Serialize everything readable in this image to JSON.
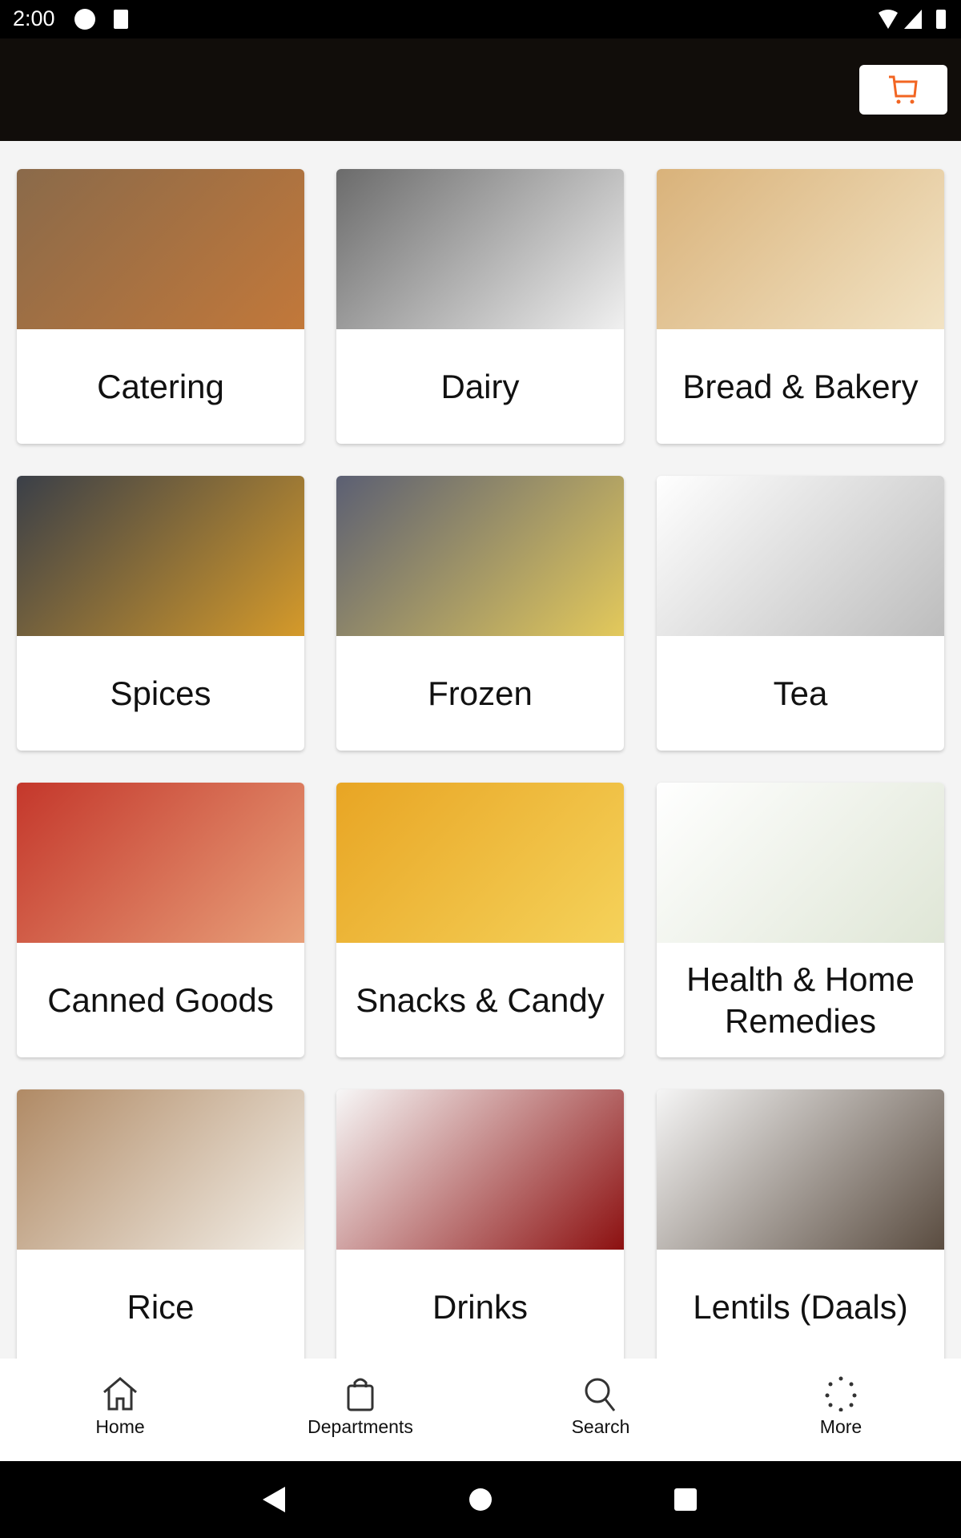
{
  "status_bar": {
    "time": "2:00"
  },
  "header": {
    "cart_icon": "shopping-cart-icon",
    "accent": "#f26522"
  },
  "categories": [
    {
      "label": "Catering",
      "colors": [
        "#8a6a4a",
        "#c2783a"
      ]
    },
    {
      "label": "Dairy",
      "colors": [
        "#6b6b6b",
        "#f0f0f0"
      ]
    },
    {
      "label": "Bread & Bakery",
      "colors": [
        "#d9b27a",
        "#f2e3c4"
      ]
    },
    {
      "label": "Spices",
      "colors": [
        "#3a3f48",
        "#d59a2a"
      ]
    },
    {
      "label": "Frozen",
      "colors": [
        "#5b5f73",
        "#e3c95b"
      ]
    },
    {
      "label": "Tea",
      "colors": [
        "#ffffff",
        "#bdbdbd"
      ]
    },
    {
      "label": "Canned Goods",
      "colors": [
        "#c4372b",
        "#e8a07a"
      ]
    },
    {
      "label": "Snacks & Candy",
      "colors": [
        "#e8a524",
        "#f5d25a"
      ]
    },
    {
      "label": "Health & Home Remedies",
      "colors": [
        "#ffffff",
        "#dfe6d6"
      ]
    },
    {
      "label": "Rice",
      "colors": [
        "#b08a65",
        "#f3efe8"
      ]
    },
    {
      "label": "Drinks",
      "colors": [
        "#f7f7f7",
        "#8c1010"
      ]
    },
    {
      "label": "Lentils (Daals)",
      "colors": [
        "#f5f5f5",
        "#5a4c40"
      ]
    }
  ],
  "bottom_nav": [
    {
      "label": "Home",
      "icon": "home-icon"
    },
    {
      "label": "Departments",
      "icon": "shopping-bag-icon"
    },
    {
      "label": "Search",
      "icon": "search-icon"
    },
    {
      "label": "More",
      "icon": "more-dots-icon"
    }
  ]
}
